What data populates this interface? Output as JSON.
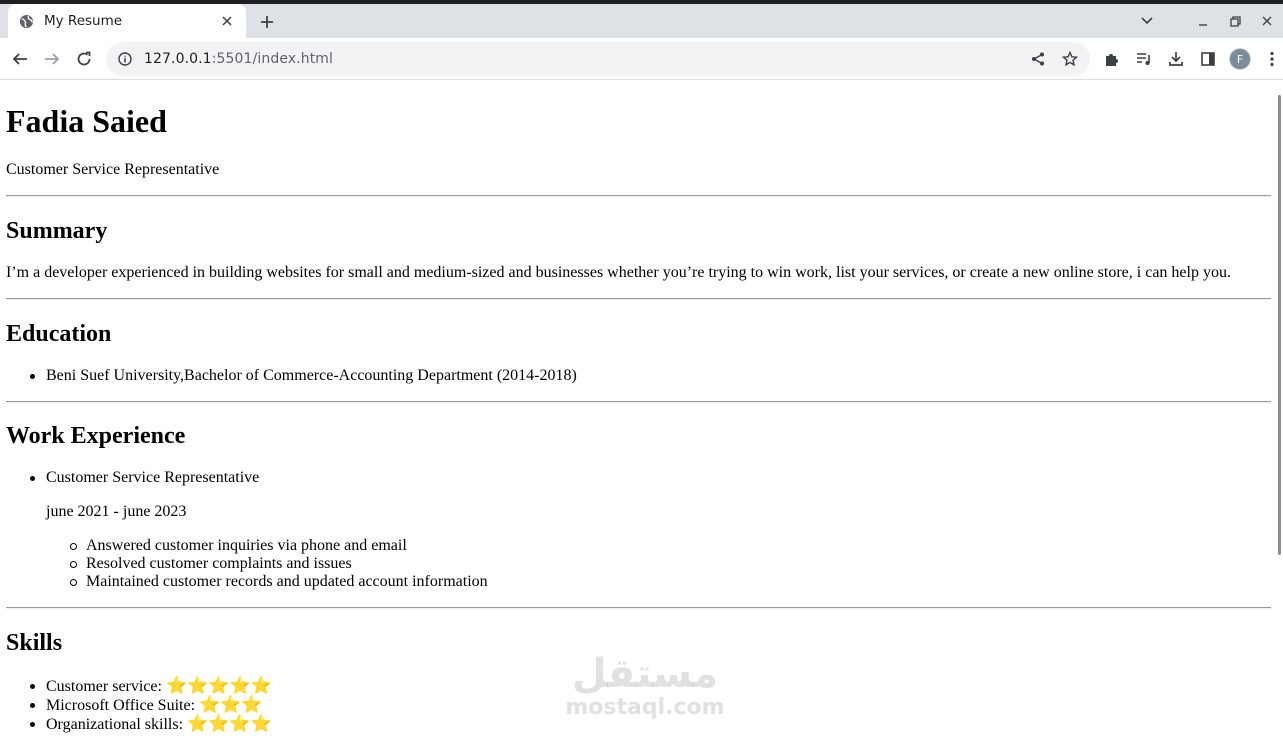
{
  "browser": {
    "tab_title": "My Resume",
    "url_host": "127.0.0.1",
    "url_rest": ":5501/index.html",
    "profile_initial": "F"
  },
  "resume": {
    "name": "Fadia Saied",
    "title": "Customer Service Representative",
    "summary": {
      "heading": "Summary",
      "text": "I’m a developer experienced in building websites for small and medium-sized and businesses whether you’re trying to win work, list your services, or create a new online store, i can help you."
    },
    "education": {
      "heading": "Education",
      "items": [
        "Beni Suef University,Bachelor of Commerce-Accounting Department (2014-2018)"
      ]
    },
    "work": {
      "heading": "Work Experience",
      "job_title": "Customer Service Representative",
      "period": "june 2021 - june 2023",
      "duties": [
        "Answered customer inquiries via phone and email",
        "Resolved customer complaints and issues",
        "Maintained customer records and updated account information"
      ]
    },
    "skills": {
      "heading": "Skills",
      "items": [
        {
          "label": "Customer service:",
          "stars": "⭐⭐⭐⭐⭐",
          "rating": 5
        },
        {
          "label": "Microsoft Office Suite:",
          "stars": "⭐⭐⭐",
          "rating": 3
        },
        {
          "label": "Organizational skills:",
          "stars": "⭐⭐⭐⭐",
          "rating": 4
        }
      ]
    }
  },
  "watermark": {
    "arabic": "مستقل",
    "latin": "mostaql.com"
  }
}
